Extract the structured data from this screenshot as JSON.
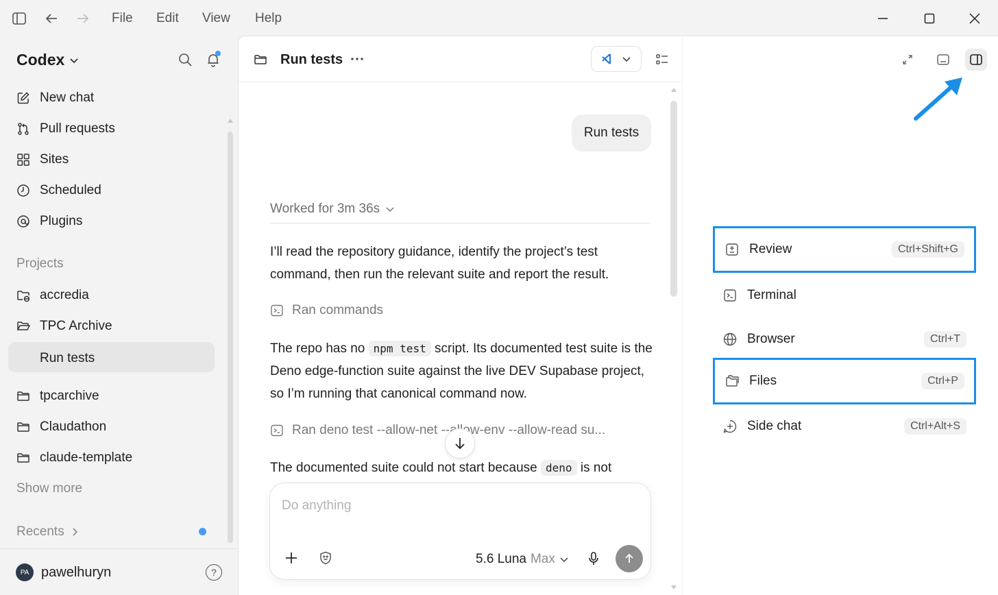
{
  "menu": {
    "file": "File",
    "edit": "Edit",
    "view": "View",
    "help": "Help"
  },
  "sidebar": {
    "brand": "Codex",
    "nav": [
      {
        "label": "New chat",
        "icon": "edit-icon"
      },
      {
        "label": "Pull requests",
        "icon": "git-pull-request-icon"
      },
      {
        "label": "Sites",
        "icon": "grid-icon"
      },
      {
        "label": "Scheduled",
        "icon": "clock-icon"
      },
      {
        "label": "Plugins",
        "icon": "plugin-icon"
      }
    ],
    "projects_label": "Projects",
    "projects": [
      {
        "label": "accredia",
        "icon": "folder-globe-icon"
      },
      {
        "label": "TPC Archive",
        "icon": "folder-open-icon"
      },
      {
        "label": "Run tests",
        "icon": ""
      },
      {
        "label": "tpcarchive",
        "icon": "folder-icon"
      },
      {
        "label": "Claudathon",
        "icon": "folder-icon"
      },
      {
        "label": "claude-template",
        "icon": "folder-icon"
      }
    ],
    "show_more": "Show more",
    "recents_label": "Recents",
    "user": {
      "initials": "PA",
      "name": "pawelhuryn"
    },
    "help": "?"
  },
  "chat": {
    "title": "Run tests",
    "user_message": "Run tests",
    "worked_for": "Worked for 3m 36s",
    "para1": "I’ll read the repository guidance, identify the project’s test command, then run the relevant suite and report the result.",
    "ran1": "Ran commands",
    "para2_a": "The repo has no ",
    "para2_code": "npm test",
    "para2_b": " script. Its documented test suite is the Deno edge-function suite against the live DEV Supabase project, so I’m running that canonical command now.",
    "ran2": "Ran deno test --allow-net --allow-env --allow-read su...",
    "para3_a": "The documented suite could not start because ",
    "para3_code": "deno",
    "para3_b": " is not"
  },
  "composer": {
    "placeholder": "Do anything",
    "model": "5.6 Luna",
    "model_variant": "Max"
  },
  "right_panel": {
    "items": [
      {
        "label": "Review",
        "shortcut": "Ctrl+Shift+G",
        "icon": "review-icon"
      },
      {
        "label": "Terminal",
        "shortcut": "",
        "icon": "terminal-icon"
      },
      {
        "label": "Browser",
        "shortcut": "Ctrl+T",
        "icon": "globe-icon"
      },
      {
        "label": "Files",
        "shortcut": "Ctrl+P",
        "icon": "folders-icon"
      },
      {
        "label": "Side chat",
        "shortcut": "Ctrl+Alt+S",
        "icon": "side-chat-icon"
      }
    ]
  },
  "colors": {
    "highlight": "#1b8fe8",
    "notification": "#4a9af5",
    "send": "#8d8d8d"
  }
}
